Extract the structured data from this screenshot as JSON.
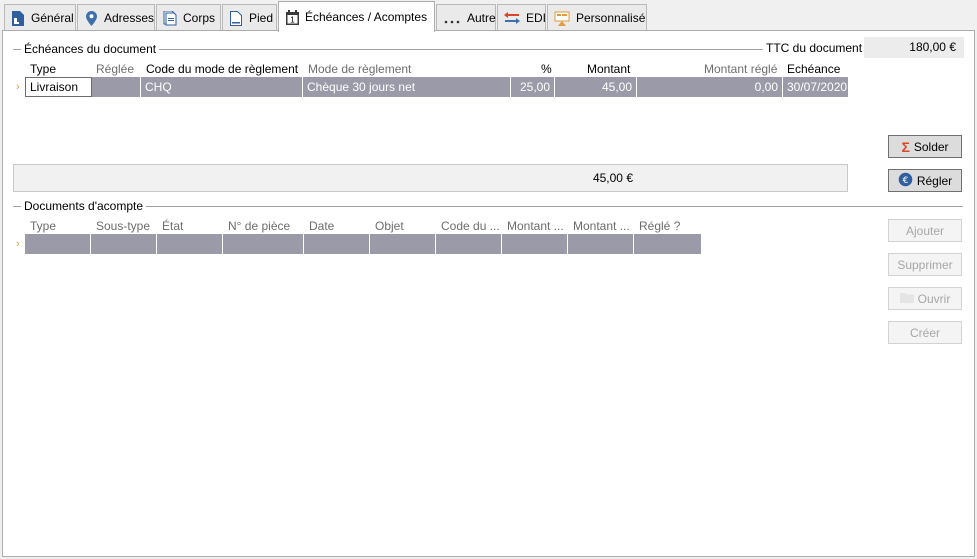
{
  "tabs": [
    {
      "label": "Général",
      "icon": "document-icon"
    },
    {
      "label": "Adresses",
      "icon": "map-pin-icon"
    },
    {
      "label": "Corps",
      "icon": "documents-icon"
    },
    {
      "label": "Pied",
      "icon": "page-icon"
    },
    {
      "label": "Échéances / Acomptes",
      "icon": "calendar-icon",
      "active": true
    },
    {
      "label": "Autre",
      "icon": "ellipsis-icon"
    },
    {
      "label": "EDI",
      "icon": "exchange-arrows-icon"
    },
    {
      "label": "Personnalisé",
      "icon": "custom-fields-icon"
    }
  ],
  "echeances": {
    "title": "Échéances du document",
    "ttc_label": "TTC du document",
    "ttc_value": "180,00 €",
    "columns": [
      "Type",
      "Réglée",
      "Code du mode de règlement",
      "Mode de règlement",
      "%",
      "Montant",
      "Montant réglé",
      "Echéance"
    ],
    "row": {
      "type": "Livraison",
      "reglee": "",
      "code": "CHQ",
      "mode": "Chèque 30 jours net",
      "pct": "25,00",
      "montant": "45,00",
      "montant_regle": "0,00",
      "echeance": "30/07/2020"
    },
    "total": "45,00 €",
    "buttons": {
      "solder": "Solder",
      "regler": "Régler"
    }
  },
  "acomptes": {
    "title": "Documents d'acompte",
    "columns": [
      "Type",
      "Sous-type",
      "État",
      "N° de pièce",
      "Date",
      "Objet",
      "Code du ...",
      "Montant ...",
      "Montant ...",
      "Réglé ?"
    ],
    "buttons": {
      "ajouter": "Ajouter",
      "supprimer": "Supprimer",
      "ouvrir": "Ouvrir",
      "creer": "Créer"
    }
  },
  "colors": {
    "row_bg": "#9a9aa8",
    "accent": "#e39a3a",
    "sigma": "#d9472b"
  }
}
